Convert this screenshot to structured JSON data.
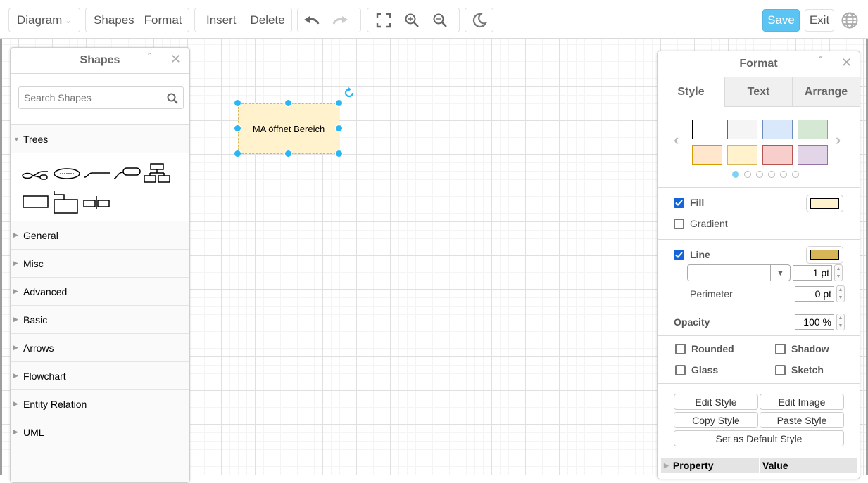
{
  "toolbar": {
    "diagram_menu": "Diagram",
    "shapes": "Shapes",
    "format": "Format",
    "insert": "Insert",
    "delete": "Delete",
    "save": "Save",
    "exit": "Exit",
    "icons": [
      "undo-icon",
      "redo-icon",
      "fullscreen-icon",
      "zoom-in-icon",
      "zoom-out-icon",
      "dark-mode-icon",
      "globe-icon"
    ]
  },
  "canvas": {
    "selected_shape": {
      "label": "MA öffnet Bereich",
      "fill_color": "#fff2cc",
      "stroke_color": "#d6b656"
    },
    "handle_color": "#29b6f2"
  },
  "shapes_panel": {
    "title": "Shapes",
    "search_placeholder": "Search Shapes",
    "expanded_section": "Trees",
    "tree_shapes": [
      "Mind map link",
      "Central Idea",
      "Branch",
      "Sub Topic",
      "Org chart",
      "Tree root",
      "Sub Tree",
      "Tree container"
    ],
    "sections": [
      "General",
      "Misc",
      "Advanced",
      "Basic",
      "Arrows",
      "Flowchart",
      "Entity Relation",
      "UML"
    ]
  },
  "format_panel": {
    "title": "Format",
    "tabs": [
      "Style",
      "Text",
      "Arrange"
    ],
    "active_tab": "Style",
    "swatches": [
      {
        "fill": "#ffffff",
        "stroke": "#000000"
      },
      {
        "fill": "#f5f5f5",
        "stroke": "#666666"
      },
      {
        "fill": "#dae8fc",
        "stroke": "#6c8ebf"
      },
      {
        "fill": "#d5e8d4",
        "stroke": "#82b366"
      },
      {
        "fill": "#ffe6cc",
        "stroke": "#d79b00"
      },
      {
        "fill": "#fff2cc",
        "stroke": "#d6b656"
      },
      {
        "fill": "#f8cecc",
        "stroke": "#b85450"
      },
      {
        "fill": "#e1d5e7",
        "stroke": "#9673a6"
      }
    ],
    "swatch_page": 1,
    "swatch_pages": 6,
    "fill": {
      "label": "Fill",
      "checked": true,
      "color": "#fff2cc"
    },
    "gradient": {
      "label": "Gradient",
      "checked": false
    },
    "line": {
      "label": "Line",
      "checked": true,
      "color": "#d6b656",
      "width": "1 pt"
    },
    "perimeter": {
      "label": "Perimeter",
      "value": "0 pt"
    },
    "opacity": {
      "label": "Opacity",
      "value": "100 %"
    },
    "options": [
      {
        "label": "Rounded",
        "checked": false
      },
      {
        "label": "Shadow",
        "checked": false
      },
      {
        "label": "Glass",
        "checked": false
      },
      {
        "label": "Sketch",
        "checked": false
      }
    ],
    "buttons": {
      "edit_style": "Edit Style",
      "edit_image": "Edit Image",
      "copy_style": "Copy Style",
      "paste_style": "Paste Style",
      "set_default": "Set as Default Style"
    },
    "property_table": {
      "col1": "Property",
      "col2": "Value"
    }
  }
}
